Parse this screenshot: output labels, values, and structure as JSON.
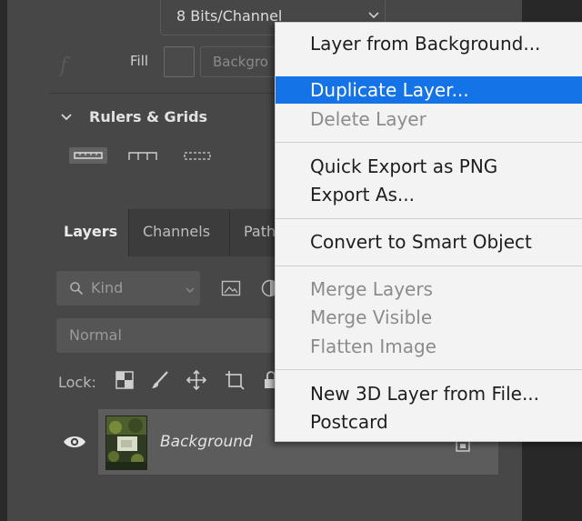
{
  "properties": {
    "bit_depth": "8 Bits/Channel",
    "fill_label": "Fill",
    "fill_field_text": "Backgro",
    "fx_icon": "f"
  },
  "rulers_grids": {
    "title": "Rulers & Grids"
  },
  "tabs": [
    {
      "label": "Layers",
      "active": true
    },
    {
      "label": "Channels",
      "active": false
    },
    {
      "label": "Path",
      "active": false
    }
  ],
  "filter": {
    "kind_placeholder": "Kind",
    "blend_mode": "Normal"
  },
  "lock": {
    "label": "Lock:"
  },
  "layer": {
    "name": "Background",
    "visible": true
  },
  "context_menu": {
    "items": [
      {
        "label": "Layer from Background...",
        "state": "enabled"
      },
      {
        "label": "Duplicate Layer...",
        "state": "highlighted"
      },
      {
        "label": "Delete Layer",
        "state": "disabled"
      },
      {
        "label": "Quick Export as PNG",
        "state": "enabled"
      },
      {
        "label": "Export As...",
        "state": "enabled"
      },
      {
        "label": "Convert to Smart Object",
        "state": "enabled"
      },
      {
        "label": "Merge Layers",
        "state": "disabled"
      },
      {
        "label": "Merge Visible",
        "state": "disabled"
      },
      {
        "label": "Flatten Image",
        "state": "disabled"
      },
      {
        "label": "New 3D Layer from File...",
        "state": "enabled"
      },
      {
        "label": "Postcard",
        "state": "enabled"
      }
    ]
  },
  "colors": {
    "panel_bg": "#474747",
    "menu_bg": "#f3f3f3",
    "highlight": "#1473e6",
    "disabled_text": "#8c8c8c"
  }
}
